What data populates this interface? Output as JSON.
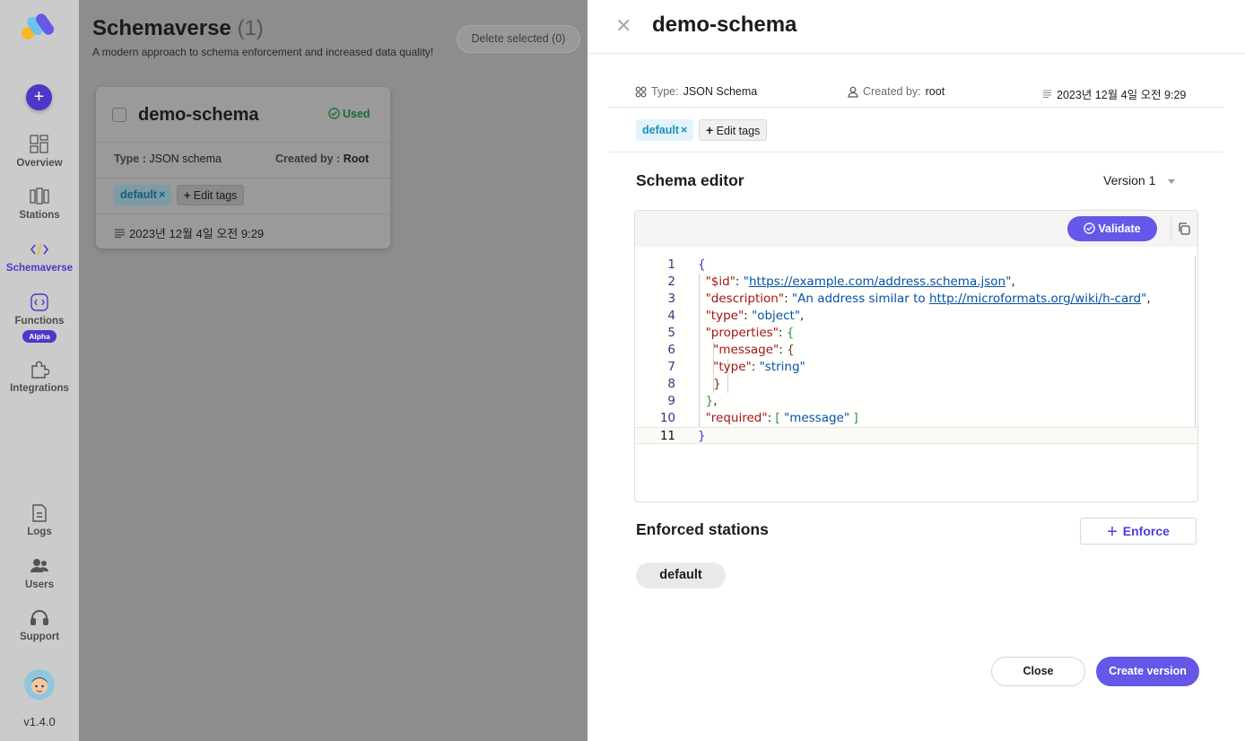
{
  "sidebar": {
    "nav": [
      {
        "label": "Overview",
        "icon": "overview-icon"
      },
      {
        "label": "Stations",
        "icon": "stations-icon"
      },
      {
        "label": "Schemaverse",
        "icon": "code-icon"
      },
      {
        "label": "Functions",
        "icon": "functions-icon",
        "badge": "Alpha"
      },
      {
        "label": "Integrations",
        "icon": "puzzle-icon"
      }
    ],
    "bottom_nav": [
      {
        "label": "Logs",
        "icon": "logs-icon"
      },
      {
        "label": "Users",
        "icon": "users-icon"
      },
      {
        "label": "Support",
        "icon": "headset-icon"
      }
    ],
    "version": "v1.4.0",
    "active": "Schemaverse",
    "accent": "#4f36c9"
  },
  "page": {
    "title": "Schemaverse",
    "count": "(1)",
    "subtitle": "A modern approach to schema enforcement and increased data quality!",
    "delete_label": "Delete selected (0)"
  },
  "card": {
    "name": "demo-schema",
    "status": "Used",
    "type_label": "Type :",
    "type_value": "JSON schema",
    "created_label": "Created by :",
    "created_value": "Root",
    "tag": "default",
    "tag_remove": "×",
    "edit_tags": "Edit tags",
    "date": "2023년 12월 4일 오전 9:29"
  },
  "drawer": {
    "title": "demo-schema",
    "type_label": "Type:",
    "type_value": "JSON Schema",
    "created_label": "Created by:",
    "created_value": "root",
    "date": "2023년 12월 4일 오전 9:29",
    "tag": "default",
    "tag_remove": "×",
    "edit_tags": "Edit tags",
    "editor_title": "Schema editor",
    "version": "Version 1",
    "validate": "Validate",
    "enforced_title": "Enforced stations",
    "enforce": "Enforce",
    "stations": [
      "default"
    ],
    "close": "Close",
    "create_version": "Create version",
    "button_color": "#6557e8"
  },
  "code": {
    "line_numbers": [
      "1",
      "2",
      "3",
      "4",
      "5",
      "6",
      "7",
      "8",
      "9",
      "10",
      "11"
    ],
    "id_key": "\"$id\"",
    "id_value": "https://example.com/address.schema.json",
    "desc_key": "\"description\"",
    "desc_prefix": "\"An address similar to ",
    "desc_url": "http://microformats.org/wiki/h-card",
    "type_key": "\"type\"",
    "type_value": "\"object\"",
    "props_key": "\"properties\"",
    "msg_key": "\"message\"",
    "inner_type_key": "\"type\"",
    "inner_type_value": "\"string\"",
    "required_key": "\"required\"",
    "required_value": "\"message\""
  }
}
